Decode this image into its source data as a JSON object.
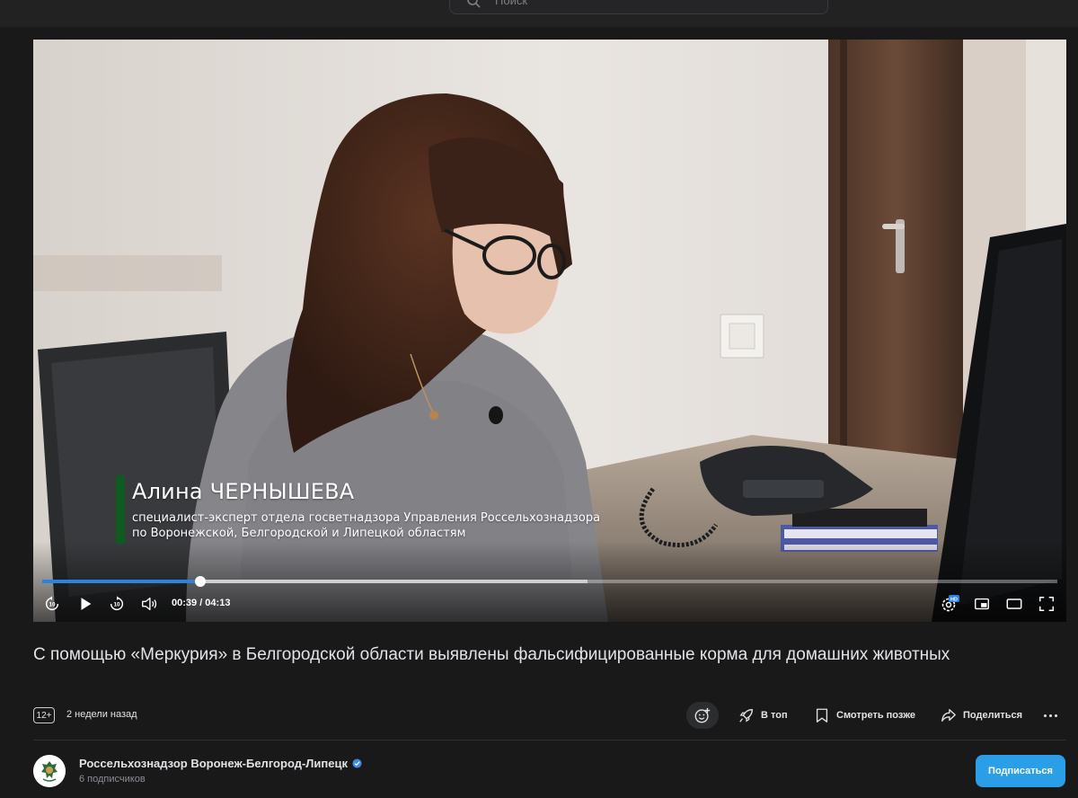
{
  "search": {
    "placeholder": "Поиск"
  },
  "video": {
    "lower_third": {
      "name": "Алина ЧЕРНЫШЕВА",
      "role_line1": "специалист-эксперт отдела госветнадзора Управления Россельхознадзора",
      "role_line2": "по Воронежской, Белгородской и Липецкой областям"
    },
    "player": {
      "time_display": "00:39 / 04:13",
      "progress_fraction": 0.156,
      "buffered_fraction": 0.537,
      "accent_color": "#2d81e0",
      "hd_badge": "HD",
      "icons": [
        "rewind-10-icon",
        "play-icon",
        "forward-10-icon",
        "volume-icon",
        "settings-icon",
        "miniplayer-icon",
        "theater-icon",
        "fullscreen-icon"
      ]
    }
  },
  "title": "С помощью «Меркурия» в Белгородской области выявлены фальсифицированные корма для домашних животных",
  "meta": {
    "age_rating": "12+",
    "posted": "2 недели назад"
  },
  "actions": {
    "top": "В топ",
    "watch_later": "Смотреть позже",
    "share": "Поделиться"
  },
  "channel": {
    "name": "Россельхознадзор Воронеж-Белгород-Липецк",
    "subscribers": "6 подписчиков",
    "verified_color": "#3f8ae0"
  },
  "subscribe": {
    "label": "Подписаться",
    "color": "#2a9ee6"
  }
}
